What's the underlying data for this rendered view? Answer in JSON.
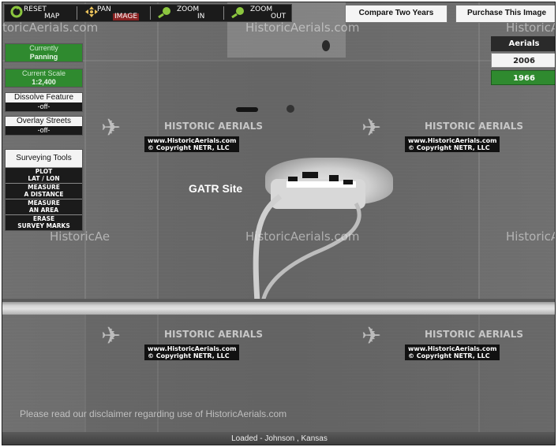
{
  "toolbar": {
    "reset": {
      "line1": "RESET",
      "line2": "MAP"
    },
    "pan": {
      "line1": "PAN",
      "line2": "IMAGE"
    },
    "zoom_in": {
      "line1": "ZOOM",
      "line2": "IN"
    },
    "zoom_out": {
      "line1": "ZOOM",
      "line2": "OUT"
    }
  },
  "top_buttons": {
    "compare": "Compare Two Years",
    "purchase": "Purchase This Image"
  },
  "left_panel": {
    "currently": {
      "label": "Currently",
      "value": "Panning"
    },
    "scale": {
      "label": "Current Scale",
      "value": "1:2,400"
    },
    "dissolve": {
      "label": "Dissolve Feature",
      "value": "-off-"
    },
    "overlay": {
      "label": "Overlay Streets",
      "value": "-off-"
    },
    "surveying_title": "Surveying Tools",
    "tools": [
      {
        "line1": "PLOT",
        "line2": "LAT / LON"
      },
      {
        "line1": "MEASURE",
        "line2": "A DISTANCE"
      },
      {
        "line1": "MEASURE",
        "line2": "AN AREA"
      },
      {
        "line1": "ERASE",
        "line2": "SURVEY MARKS"
      }
    ]
  },
  "aerials": {
    "title": "Aerials",
    "years": [
      "2006",
      "1966"
    ],
    "selected": "1966"
  },
  "map": {
    "site_label": "GATR  Site",
    "watermark_text": "HistoricAerials.com",
    "watermark_partial": "HistoricAe",
    "watermark_partial_left": "toricAerials.com",
    "logo_title": "HISTORIC AERIALS",
    "logo_url": "www.HistoricAerials.com",
    "logo_copy": "© Copyright NETR, LLC",
    "disclaimer": "Please read our disclaimer regarding use of HistoricAerials.com"
  },
  "status": {
    "text": "Loaded - Johnson , Kansas"
  },
  "colors": {
    "accent_green": "#2f8a2f",
    "toolbar_bg": "#1b1b1b"
  },
  "icons": [
    "reset-icon",
    "pan-icon",
    "zoom-in-icon",
    "zoom-out-icon",
    "biplane-icon"
  ]
}
